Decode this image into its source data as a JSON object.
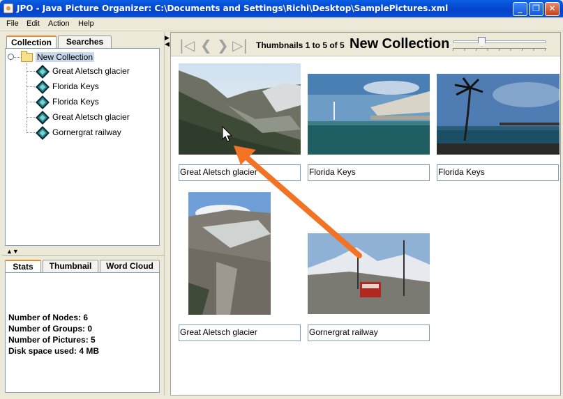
{
  "window": {
    "title": "JPO - Java Picture Organizer:  C:\\Documents and Settings\\Richi\\Desktop\\SamplePictures.xml",
    "min_label": "_",
    "max_label": "❐",
    "close_label": "✕"
  },
  "menu": [
    "File",
    "Edit",
    "Action",
    "Help"
  ],
  "top_tabs": [
    "Collection",
    "Searches"
  ],
  "tree": {
    "root": "New Collection",
    "children": [
      "Great Aletsch glacier",
      "Florida Keys",
      "Florida Keys",
      "Great Aletsch glacier",
      "Gornergrat railway"
    ]
  },
  "bottom_tabs": [
    "Stats",
    "Thumbnail",
    "Word Cloud"
  ],
  "stats": {
    "nodes": "Number of Nodes: 6",
    "groups": "Number of Groups: 0",
    "pictures": "Number of Pictures: 5",
    "disk": "Disk space used: 4 MB"
  },
  "toolbar": {
    "first_icon": "first-page-icon",
    "prev_icon": "previous-page-icon",
    "next_icon": "next-page-icon",
    "last_icon": "last-page-icon",
    "thumb_count": "Thumbnails 1 to 5 of 5",
    "collection_title": "New Collection",
    "zoom_slider_level": 0.35
  },
  "thumbnails": [
    {
      "caption": "Great Aletsch glacier"
    },
    {
      "caption": "Florida Keys"
    },
    {
      "caption": "Florida Keys"
    },
    {
      "caption": "Great Aletsch glacier"
    },
    {
      "caption": "Gornergrat railway"
    }
  ],
  "colors": {
    "drag_arrow": "#f27324",
    "selection": "#c8d7ea",
    "tab_accent": "#e68b2c"
  }
}
